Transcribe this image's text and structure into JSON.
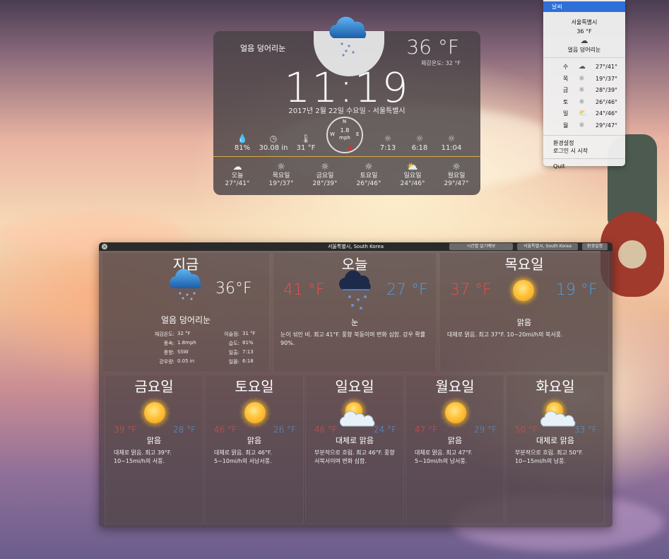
{
  "widget": {
    "condition": "얼음 덩어리눈",
    "temp": "36 °F",
    "feels": "체감온도:  32 °F",
    "time": "11:19",
    "date": "2017년 2월 22일 수요일 - 서울특별시",
    "stats": [
      {
        "icon": "humidity-icon",
        "glyph": "💧",
        "value": "81%"
      },
      {
        "icon": "pressure-icon",
        "glyph": "◷",
        "value": "30.08 in"
      },
      {
        "icon": "dewpoint-icon",
        "glyph": "🌡",
        "value": "31 °F"
      },
      {
        "icon": "sunrise-icon",
        "glyph": "☼",
        "value": "7:13"
      },
      {
        "icon": "sunset-icon",
        "glyph": "☼",
        "value": "6:18"
      },
      {
        "icon": "sun-icon",
        "glyph": "☼",
        "value": "11:04"
      }
    ],
    "compass": {
      "n": "N",
      "e": "E",
      "w": "W",
      "speed": "1.8",
      "unit": "mph"
    },
    "forecast": [
      {
        "day": "오늘",
        "range": "27°/41°",
        "glyph": "☁"
      },
      {
        "day": "목요일",
        "range": "19°/37°",
        "glyph": "☼"
      },
      {
        "day": "금요일",
        "range": "28°/39°",
        "glyph": "☼"
      },
      {
        "day": "토요일",
        "range": "26°/46°",
        "glyph": "☼"
      },
      {
        "day": "일요일",
        "range": "24°/46°",
        "glyph": "⛅"
      },
      {
        "day": "월요일",
        "range": "29°/47°",
        "glyph": "☼"
      }
    ]
  },
  "menu": {
    "selected": "날씨",
    "city": "서울특별시",
    "temp": "36 °F",
    "cloud_glyph": "☁",
    "condition": "얼음 덩어리눈",
    "days": [
      {
        "day": "수",
        "glyph": "☁",
        "range": "27°/41°"
      },
      {
        "day": "목",
        "glyph": "☼",
        "range": "19°/37°"
      },
      {
        "day": "금",
        "glyph": "☼",
        "range": "28°/39°"
      },
      {
        "day": "토",
        "glyph": "☼",
        "range": "26°/46°"
      },
      {
        "day": "일",
        "glyph": "⛅",
        "range": "24°/46°"
      },
      {
        "day": "월",
        "glyph": "☼",
        "range": "29°/47°"
      }
    ],
    "prefs": "환경설정",
    "login": "로그인 시 시작",
    "quit": "Quit"
  },
  "detail": {
    "title": "서울특별시, South Korea",
    "close_glyph": "×",
    "btn_hourly": "시간별 일기예보",
    "btn_location": "서울특별시, South Korea",
    "btn_prefs": "환경설정",
    "now": {
      "title": "지금",
      "temp": "36°F",
      "condition": "얼음 덩어리눈",
      "left": [
        {
          "k": "체감온도:",
          "v": "32 °F"
        },
        {
          "k": "풍속:",
          "v": "1.8mph"
        },
        {
          "k": "풍향:",
          "v": "SSW"
        },
        {
          "k": "강우량:",
          "v": "0.05 in"
        }
      ],
      "right": [
        {
          "k": "이슬점:",
          "v": "31 °F"
        },
        {
          "k": "습도:",
          "v": "81%"
        },
        {
          "k": "일출:",
          "v": "7:13"
        },
        {
          "k": "일몰:",
          "v": "6:18"
        }
      ]
    },
    "today": {
      "title": "오늘",
      "hi": "41 °F",
      "lo": "27 °F",
      "word": "눈",
      "desc": "눈이 섞인 비. 최고 41°F. 풍향 북동이며 변화 심함. 강우 확률 90%."
    },
    "thu": {
      "title": "목요일",
      "hi": "37 °F",
      "lo": "19 °F",
      "word": "맑음",
      "desc": "대체로 맑음. 최고 37°F. 10~20mi/h의 북서풍."
    },
    "days": [
      {
        "title": "금요일",
        "hi": "39 °F",
        "lo": "28 °F",
        "word": "맑음",
        "icon": "sun",
        "desc": "대체로 맑음. 최고 39°F. 10~15mi/h의 서풍."
      },
      {
        "title": "토요일",
        "hi": "46 °F",
        "lo": "26 °F",
        "word": "맑음",
        "icon": "sun",
        "desc": "대체로 맑음. 최고 46°F. 5~10mi/h의 서남서풍."
      },
      {
        "title": "일요일",
        "hi": "46 °F",
        "lo": "24 °F",
        "word": "대체로 맑음",
        "icon": "partly",
        "desc": "부분적으로 흐림. 최고 46°F. 풍향 서북서이며 변화 심함."
      },
      {
        "title": "월요일",
        "hi": "47 °F",
        "lo": "29 °F",
        "word": "맑음",
        "icon": "sun",
        "desc": "대체로 맑음. 최고 47°F. 5~10mi/h의 남서풍."
      },
      {
        "title": "화요일",
        "hi": "50 °F",
        "lo": "33 °F",
        "word": "대체로 맑음",
        "icon": "partly",
        "desc": "부분적으로 흐림. 최고 50°F. 10~15mi/h의 남풍."
      }
    ]
  }
}
